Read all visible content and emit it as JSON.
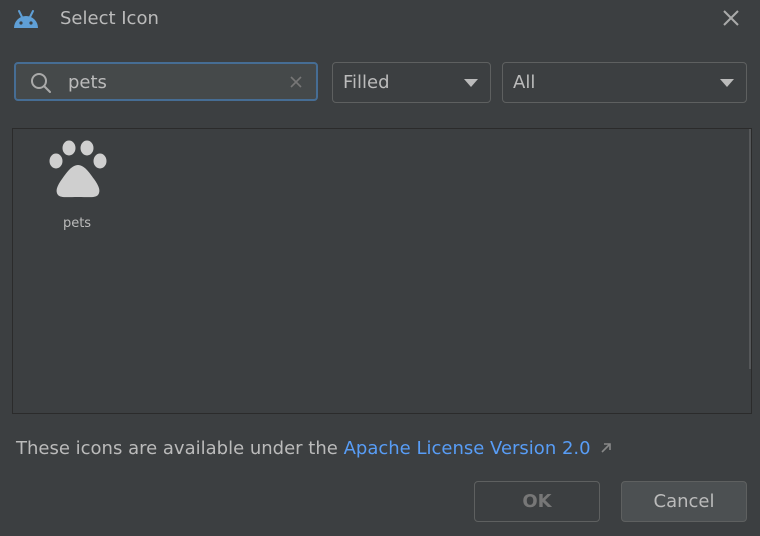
{
  "window": {
    "title": "Select Icon",
    "app_icon": "android-icon",
    "close_icon": "close-icon"
  },
  "search": {
    "value": "pets",
    "placeholder": "",
    "search_icon": "search-icon",
    "clear_icon": "clear-icon"
  },
  "filters": {
    "style_selected": "Filled",
    "category_selected": "All"
  },
  "icons": [
    {
      "label": "pets",
      "icon": "paw-icon"
    }
  ],
  "license": {
    "text": "These icons are available under the ",
    "link_text": "Apache License Version 2.0",
    "link_icon": "external-link-icon"
  },
  "buttons": {
    "ok_label": "OK",
    "cancel_label": "Cancel"
  },
  "colors": {
    "background": "#3c3f41",
    "accent_border": "#466d94",
    "link": "#589df6",
    "android_green": "#6fa8dc"
  }
}
